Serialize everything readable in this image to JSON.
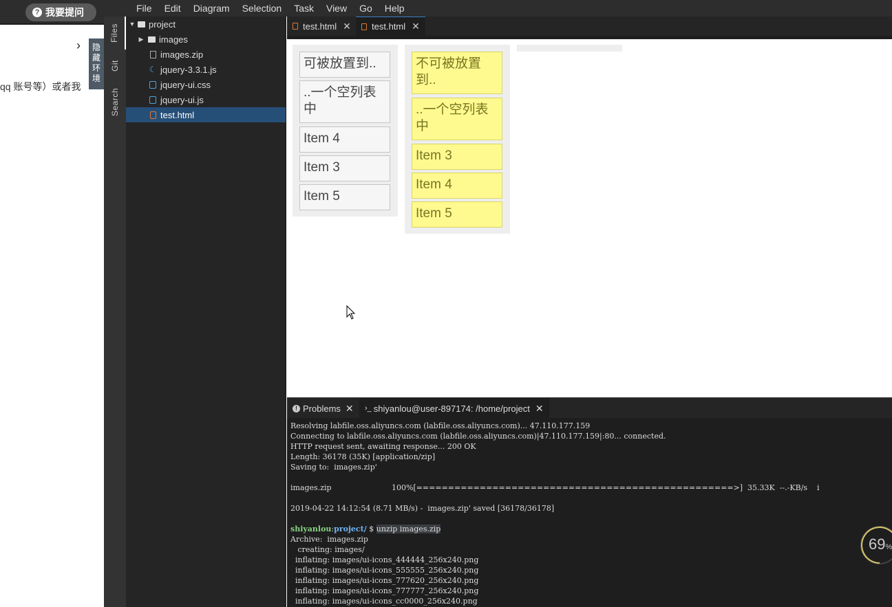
{
  "host": {
    "ask_button": "我要提问",
    "side_text": "qq 账号等）或者我",
    "hide_env_label": "隐藏环境"
  },
  "menu": [
    "File",
    "Edit",
    "Diagram",
    "Selection",
    "Task",
    "View",
    "Go",
    "Help"
  ],
  "activity": {
    "files": "Files",
    "git": "Git",
    "search": "Search"
  },
  "tree": {
    "root": "project",
    "items": [
      {
        "label": "images",
        "type": "folder"
      },
      {
        "label": "images.zip",
        "type": "zip"
      },
      {
        "label": "jquery-3.3.1.js",
        "type": "js"
      },
      {
        "label": "jquery-ui.css",
        "type": "css"
      },
      {
        "label": "jquery-ui.js",
        "type": "js"
      },
      {
        "label": "test.html",
        "type": "html",
        "selected": true
      }
    ]
  },
  "tabs": [
    {
      "label": "test.html",
      "active": false
    },
    {
      "label": "test.html",
      "active": true
    }
  ],
  "preview": {
    "list1": [
      "可被放置到..",
      "..一个空列表中",
      "Item 4",
      "Item 3",
      "Item 5"
    ],
    "list2": [
      "不可被放置到..",
      "..一个空列表中",
      "Item 3",
      "Item 4",
      "Item 5"
    ]
  },
  "panel": {
    "problems_tab": "Problems",
    "terminal_tab": "shiyanlou@user-897174: /home/project"
  },
  "terminal": {
    "lines": [
      "Resolving labfile.oss.aliyuncs.com (labfile.oss.aliyuncs.com)... 47.110.177.159",
      "Connecting to labfile.oss.aliyuncs.com (labfile.oss.aliyuncs.com)|47.110.177.159|:80... connected.",
      "HTTP request sent, awaiting response... 200 OK",
      "Length: 36178 (35K) [application/zip]",
      "Saving to:  images.zip'",
      "",
      "images.zip                         100%[==================================================>]  35.33K  --.-KB/s    i",
      "",
      "2019-04-22 14:12:54 (8.71 MB/s) -  images.zip' saved [36178/36178]",
      ""
    ],
    "prompt_user": "shiyanlou",
    "prompt_path": "project/",
    "prompt_symbol": " $ ",
    "command": "unzip images.zip",
    "after": [
      "Archive:  images.zip",
      "   creating: images/",
      "  inflating: images/ui-icons_444444_256x240.png",
      "  inflating: images/ui-icons_555555_256x240.png",
      "  inflating: images/ui-icons_777620_256x240.png",
      "  inflating: images/ui-icons_777777_256x240.png",
      "  inflating: images/ui-icons_cc0000_256x240.png"
    ]
  },
  "gauge": {
    "value": "69",
    "unit": "%",
    "fraction": 0.69
  }
}
